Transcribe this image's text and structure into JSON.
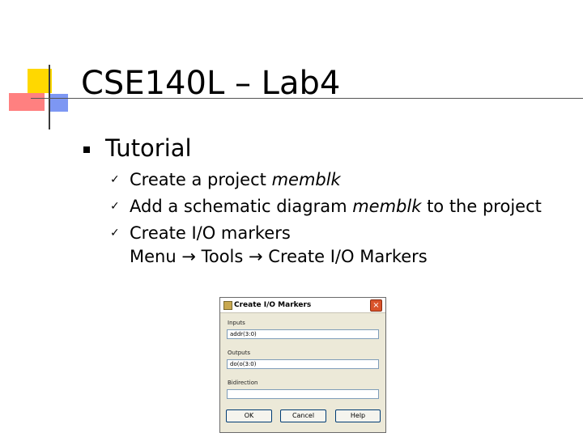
{
  "slide": {
    "title": "CSE140L – Lab4",
    "bullet": "Tutorial",
    "items": [
      {
        "text": "Create a project ",
        "italic": "memblk"
      },
      {
        "text": "Add a schematic diagram ",
        "italic": "memblk",
        "text_after": " to the project"
      },
      {
        "line1": "Create I/O markers",
        "line2": "Menu → Tools → Create I/O Markers"
      }
    ]
  },
  "dialog": {
    "title": "Create I/O Markers",
    "close_label": "×",
    "inputs_label": "Inputs",
    "inputs_value": "addr(3:0)",
    "outputs_label": "Outputs",
    "outputs_value": "do(o(3:0)",
    "bidirection_label": "Bidirection",
    "bidirection_value": "",
    "ok_label": "OK",
    "cancel_label": "Cancel",
    "help_label": "Help"
  }
}
